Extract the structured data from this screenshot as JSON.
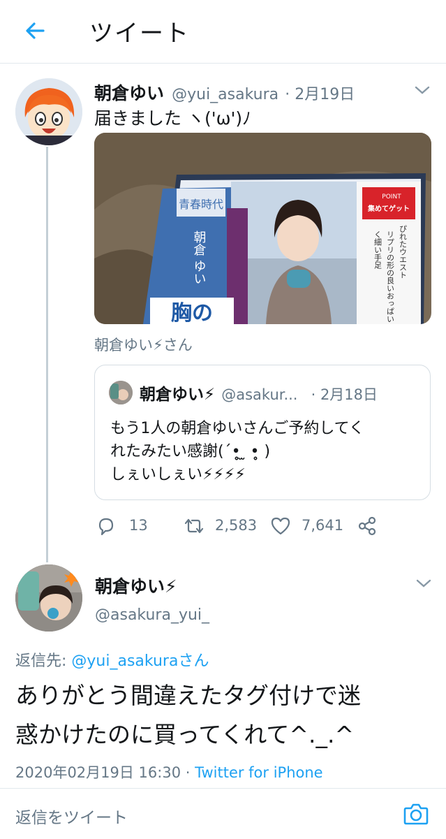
{
  "header": {
    "title": "ツイート"
  },
  "tweet1": {
    "name": "朝倉ゆい",
    "handle": "@yui_asakura",
    "date": "· 2月19日",
    "text": "届きました ヽ('ω')ﾉ",
    "dvd": {
      "series": "青春時代",
      "actress": "朝倉 ゆい",
      "tagline1": "ぴれたウエスト",
      "tagline2": "リプリの形の良いおっぱい",
      "tagline3": "く細い手足",
      "badge_top": "POINT",
      "badge_main": "集めてゲット",
      "big_title": "胸の"
    },
    "mention_line": "朝倉ゆい⚡さん",
    "quote": {
      "name": "朝倉ゆい⚡",
      "handle": "@asakur...",
      "date": "· 2月18日",
      "line1": "もう1人の朝倉ゆいさんご予約してく",
      "line2": "れたみたい感謝(´•̥̥̥ ̫ •̥̥̥ )",
      "line3": "しぇいしぇい⚡⚡⚡⚡"
    },
    "stats": {
      "replies": "13",
      "retweets": "2,583",
      "likes": "7,641"
    }
  },
  "tweet2": {
    "name": "朝倉ゆい⚡",
    "handle": "@asakura_yui_",
    "reply_to_prefix": "返信先: ",
    "reply_to_user": "@yui_asakuraさん",
    "text_line1": "ありがとう間違えたタグ付けで迷",
    "text_line2": "惑かけたのに買ってくれて^._.^",
    "timestamp": "2020年02月19日 16:30 · ",
    "client": "Twitter for iPhone"
  },
  "reply_box": {
    "placeholder": "返信をツイート"
  },
  "colors": {
    "accent": "#1da1f2",
    "secondary_text": "#657786",
    "border": "#e1e8ed"
  }
}
